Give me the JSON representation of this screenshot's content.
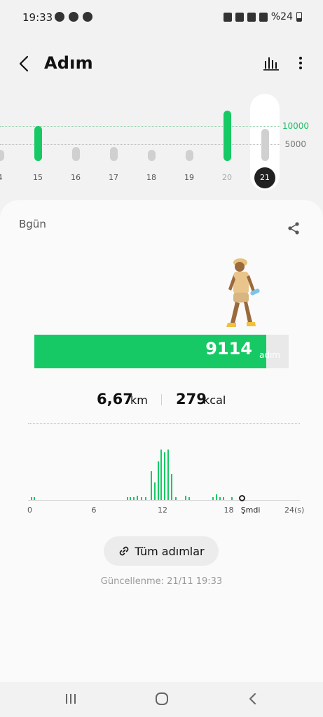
{
  "status": {
    "time": "19:33",
    "battery": "%24"
  },
  "header": {
    "title": "Adım"
  },
  "week": {
    "days": [
      {
        "label": "4",
        "steps": 3100,
        "state": "normal"
      },
      {
        "label": "15",
        "steps": 10100,
        "state": "goal"
      },
      {
        "label": "16",
        "steps": 4100,
        "state": "normal"
      },
      {
        "label": "17",
        "steps": 4000,
        "state": "normal"
      },
      {
        "label": "18",
        "steps": 1000,
        "state": "normal"
      },
      {
        "label": "19",
        "steps": 1200,
        "state": "normal"
      },
      {
        "label": "20",
        "steps": 14500,
        "state": "goal-muted"
      },
      {
        "label": "21",
        "steps": 9114,
        "state": "selected"
      }
    ],
    "goal_label": "10000",
    "mid_label": "5000"
  },
  "today": {
    "label": "Bgün",
    "steps": "9114",
    "steps_unit": "adım",
    "goal_fraction": 0.911,
    "distance": "6,67",
    "distance_unit": "km",
    "calories": "279",
    "calories_unit": "kcal"
  },
  "hourly": {
    "ticks": [
      "0",
      "6",
      "12",
      "18",
      "Şmdi",
      "24(s)"
    ],
    "bars": [
      {
        "hour": 0.1,
        "value": 2
      },
      {
        "hour": 0.4,
        "value": 2
      },
      {
        "hour": 8.8,
        "value": 2
      },
      {
        "hour": 9.1,
        "value": 2
      },
      {
        "hour": 9.4,
        "value": 2
      },
      {
        "hour": 9.7,
        "value": 3
      },
      {
        "hour": 10.1,
        "value": 2
      },
      {
        "hour": 10.5,
        "value": 2
      },
      {
        "hour": 11.0,
        "value": 20
      },
      {
        "hour": 11.3,
        "value": 12
      },
      {
        "hour": 11.6,
        "value": 27
      },
      {
        "hour": 11.9,
        "value": 35
      },
      {
        "hour": 12.2,
        "value": 33
      },
      {
        "hour": 12.5,
        "value": 35
      },
      {
        "hour": 12.8,
        "value": 18
      },
      {
        "hour": 13.2,
        "value": 2
      },
      {
        "hour": 14.1,
        "value": 3
      },
      {
        "hour": 14.4,
        "value": 2
      },
      {
        "hour": 16.6,
        "value": 2
      },
      {
        "hour": 16.9,
        "value": 4
      },
      {
        "hour": 17.2,
        "value": 2
      },
      {
        "hour": 17.5,
        "value": 2
      },
      {
        "hour": 18.3,
        "value": 2
      }
    ],
    "max_value": 38
  },
  "actions": {
    "all_steps": "Tüm adımlar"
  },
  "updated": "Güncellenme: 21/11 19:33",
  "colors": {
    "accent": "#17c964",
    "track": "#e9e9e9",
    "inactive_bar": "#d0d0d0"
  }
}
